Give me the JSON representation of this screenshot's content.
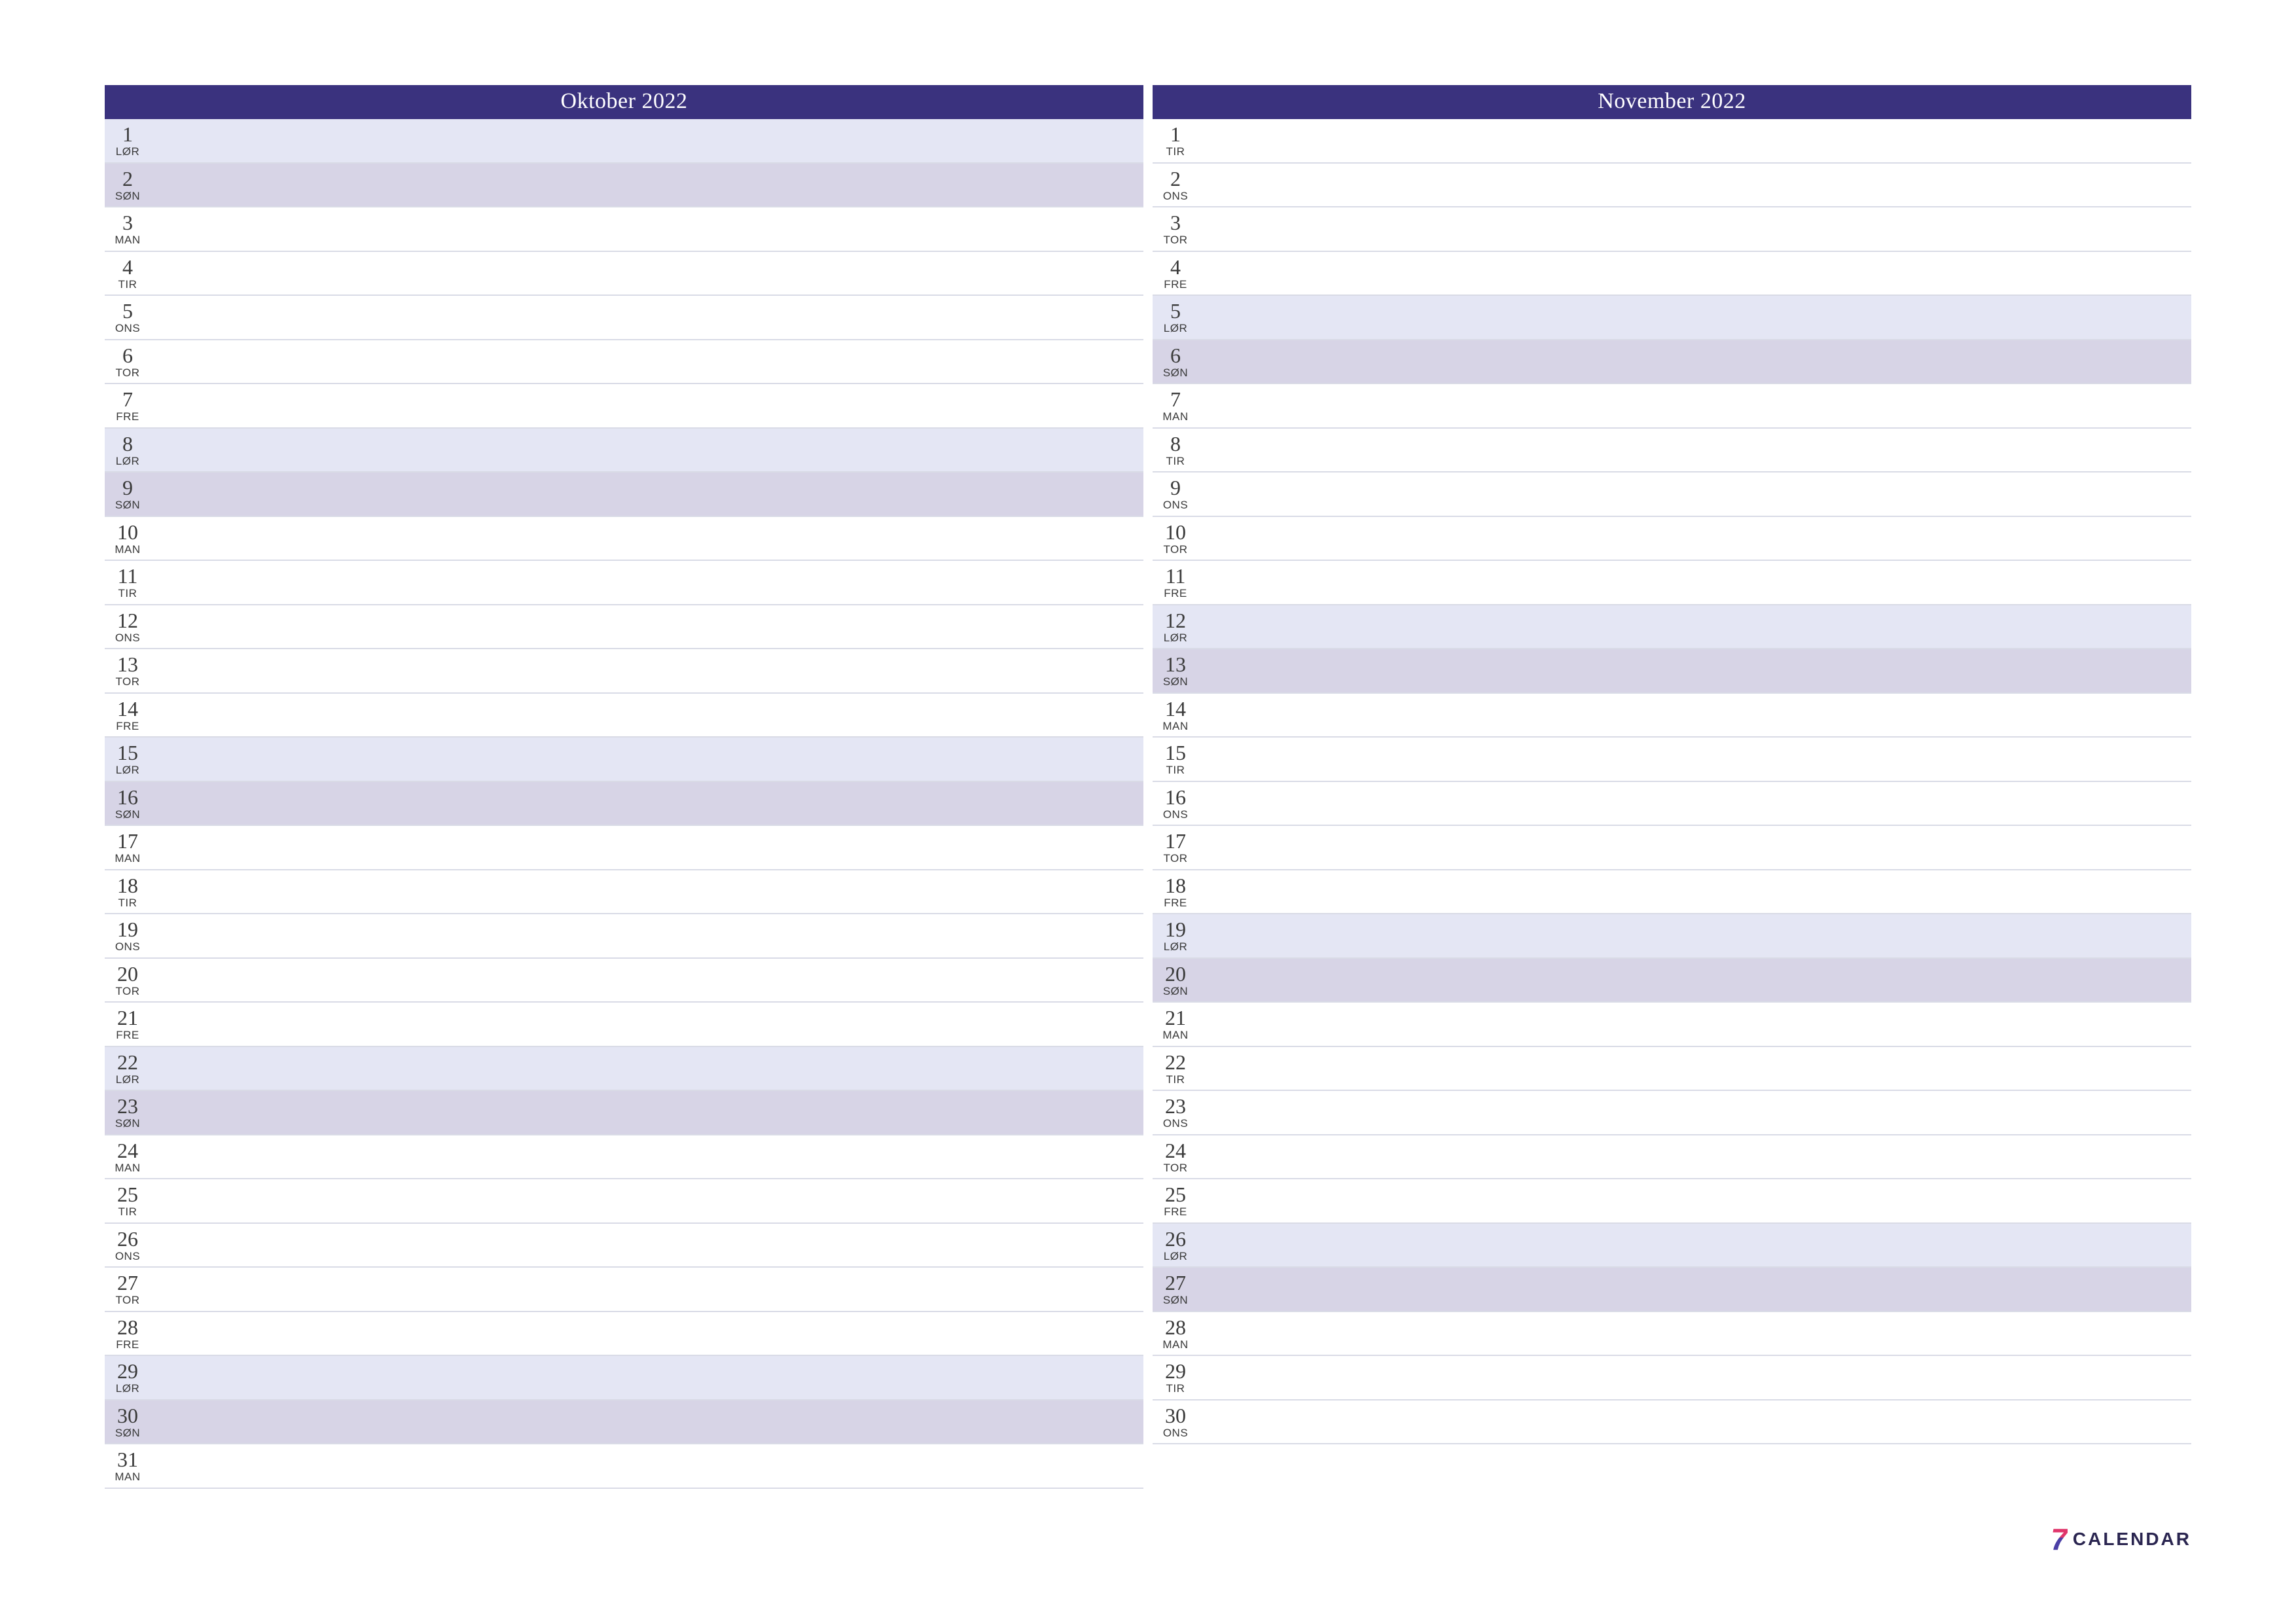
{
  "months": [
    {
      "title": "Oktober 2022",
      "days": [
        {
          "n": "1",
          "wd": "LØR",
          "t": "sat"
        },
        {
          "n": "2",
          "wd": "SØN",
          "t": "sun"
        },
        {
          "n": "3",
          "wd": "MAN",
          "t": ""
        },
        {
          "n": "4",
          "wd": "TIR",
          "t": ""
        },
        {
          "n": "5",
          "wd": "ONS",
          "t": ""
        },
        {
          "n": "6",
          "wd": "TOR",
          "t": ""
        },
        {
          "n": "7",
          "wd": "FRE",
          "t": ""
        },
        {
          "n": "8",
          "wd": "LØR",
          "t": "sat"
        },
        {
          "n": "9",
          "wd": "SØN",
          "t": "sun"
        },
        {
          "n": "10",
          "wd": "MAN",
          "t": ""
        },
        {
          "n": "11",
          "wd": "TIR",
          "t": ""
        },
        {
          "n": "12",
          "wd": "ONS",
          "t": ""
        },
        {
          "n": "13",
          "wd": "TOR",
          "t": ""
        },
        {
          "n": "14",
          "wd": "FRE",
          "t": ""
        },
        {
          "n": "15",
          "wd": "LØR",
          "t": "sat"
        },
        {
          "n": "16",
          "wd": "SØN",
          "t": "sun"
        },
        {
          "n": "17",
          "wd": "MAN",
          "t": ""
        },
        {
          "n": "18",
          "wd": "TIR",
          "t": ""
        },
        {
          "n": "19",
          "wd": "ONS",
          "t": ""
        },
        {
          "n": "20",
          "wd": "TOR",
          "t": ""
        },
        {
          "n": "21",
          "wd": "FRE",
          "t": ""
        },
        {
          "n": "22",
          "wd": "LØR",
          "t": "sat"
        },
        {
          "n": "23",
          "wd": "SØN",
          "t": "sun"
        },
        {
          "n": "24",
          "wd": "MAN",
          "t": ""
        },
        {
          "n": "25",
          "wd": "TIR",
          "t": ""
        },
        {
          "n": "26",
          "wd": "ONS",
          "t": ""
        },
        {
          "n": "27",
          "wd": "TOR",
          "t": ""
        },
        {
          "n": "28",
          "wd": "FRE",
          "t": ""
        },
        {
          "n": "29",
          "wd": "LØR",
          "t": "sat"
        },
        {
          "n": "30",
          "wd": "SØN",
          "t": "sun"
        },
        {
          "n": "31",
          "wd": "MAN",
          "t": ""
        }
      ]
    },
    {
      "title": "November 2022",
      "days": [
        {
          "n": "1",
          "wd": "TIR",
          "t": ""
        },
        {
          "n": "2",
          "wd": "ONS",
          "t": ""
        },
        {
          "n": "3",
          "wd": "TOR",
          "t": ""
        },
        {
          "n": "4",
          "wd": "FRE",
          "t": ""
        },
        {
          "n": "5",
          "wd": "LØR",
          "t": "sat"
        },
        {
          "n": "6",
          "wd": "SØN",
          "t": "sun"
        },
        {
          "n": "7",
          "wd": "MAN",
          "t": ""
        },
        {
          "n": "8",
          "wd": "TIR",
          "t": ""
        },
        {
          "n": "9",
          "wd": "ONS",
          "t": ""
        },
        {
          "n": "10",
          "wd": "TOR",
          "t": ""
        },
        {
          "n": "11",
          "wd": "FRE",
          "t": ""
        },
        {
          "n": "12",
          "wd": "LØR",
          "t": "sat"
        },
        {
          "n": "13",
          "wd": "SØN",
          "t": "sun"
        },
        {
          "n": "14",
          "wd": "MAN",
          "t": ""
        },
        {
          "n": "15",
          "wd": "TIR",
          "t": ""
        },
        {
          "n": "16",
          "wd": "ONS",
          "t": ""
        },
        {
          "n": "17",
          "wd": "TOR",
          "t": ""
        },
        {
          "n": "18",
          "wd": "FRE",
          "t": ""
        },
        {
          "n": "19",
          "wd": "LØR",
          "t": "sat"
        },
        {
          "n": "20",
          "wd": "SØN",
          "t": "sun"
        },
        {
          "n": "21",
          "wd": "MAN",
          "t": ""
        },
        {
          "n": "22",
          "wd": "TIR",
          "t": ""
        },
        {
          "n": "23",
          "wd": "ONS",
          "t": ""
        },
        {
          "n": "24",
          "wd": "TOR",
          "t": ""
        },
        {
          "n": "25",
          "wd": "FRE",
          "t": ""
        },
        {
          "n": "26",
          "wd": "LØR",
          "t": "sat"
        },
        {
          "n": "27",
          "wd": "SØN",
          "t": "sun"
        },
        {
          "n": "28",
          "wd": "MAN",
          "t": ""
        },
        {
          "n": "29",
          "wd": "TIR",
          "t": ""
        },
        {
          "n": "30",
          "wd": "ONS",
          "t": ""
        }
      ]
    }
  ],
  "logo": {
    "seven": "7",
    "text": "CALENDAR"
  }
}
